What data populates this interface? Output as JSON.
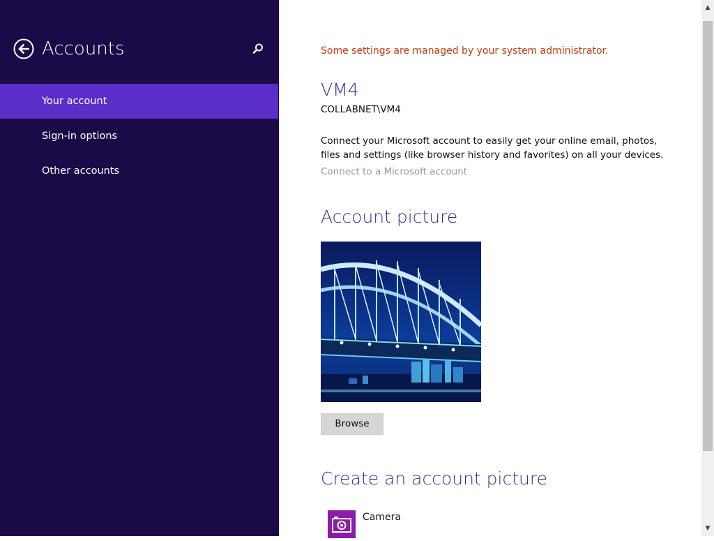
{
  "sidebar": {
    "title": "Accounts",
    "back_icon": "back-arrow-icon",
    "search_icon": "search-icon",
    "items": [
      {
        "label": "Your account",
        "selected": true
      },
      {
        "label": "Sign-in options",
        "selected": false
      },
      {
        "label": "Other accounts",
        "selected": false
      }
    ],
    "colors": {
      "background": "#1b0a48",
      "selected": "#5b2ec9"
    }
  },
  "main": {
    "admin_notice": "Some settings are managed by your system administrator.",
    "user": {
      "name": "VM4",
      "domain": "COLLABNET\\VM4"
    },
    "connect": {
      "description": "Connect your Microsoft account to easily get your online email, photos, files and settings (like browser history and favorites) on all your devices.",
      "link": "Connect to a Microsoft account"
    },
    "account_picture": {
      "title": "Account picture",
      "browse_label": "Browse"
    },
    "create_picture": {
      "title": "Create an account picture",
      "camera_label": "Camera",
      "camera_icon": "camera-icon"
    },
    "colors": {
      "accent": "#3b2a9a",
      "notice": "#c93a0d",
      "camera_tile": "#8a1ea6"
    }
  },
  "scrollbar": {
    "up_icon": "scroll-up-arrow-icon",
    "down_icon": "scroll-down-arrow-icon"
  }
}
